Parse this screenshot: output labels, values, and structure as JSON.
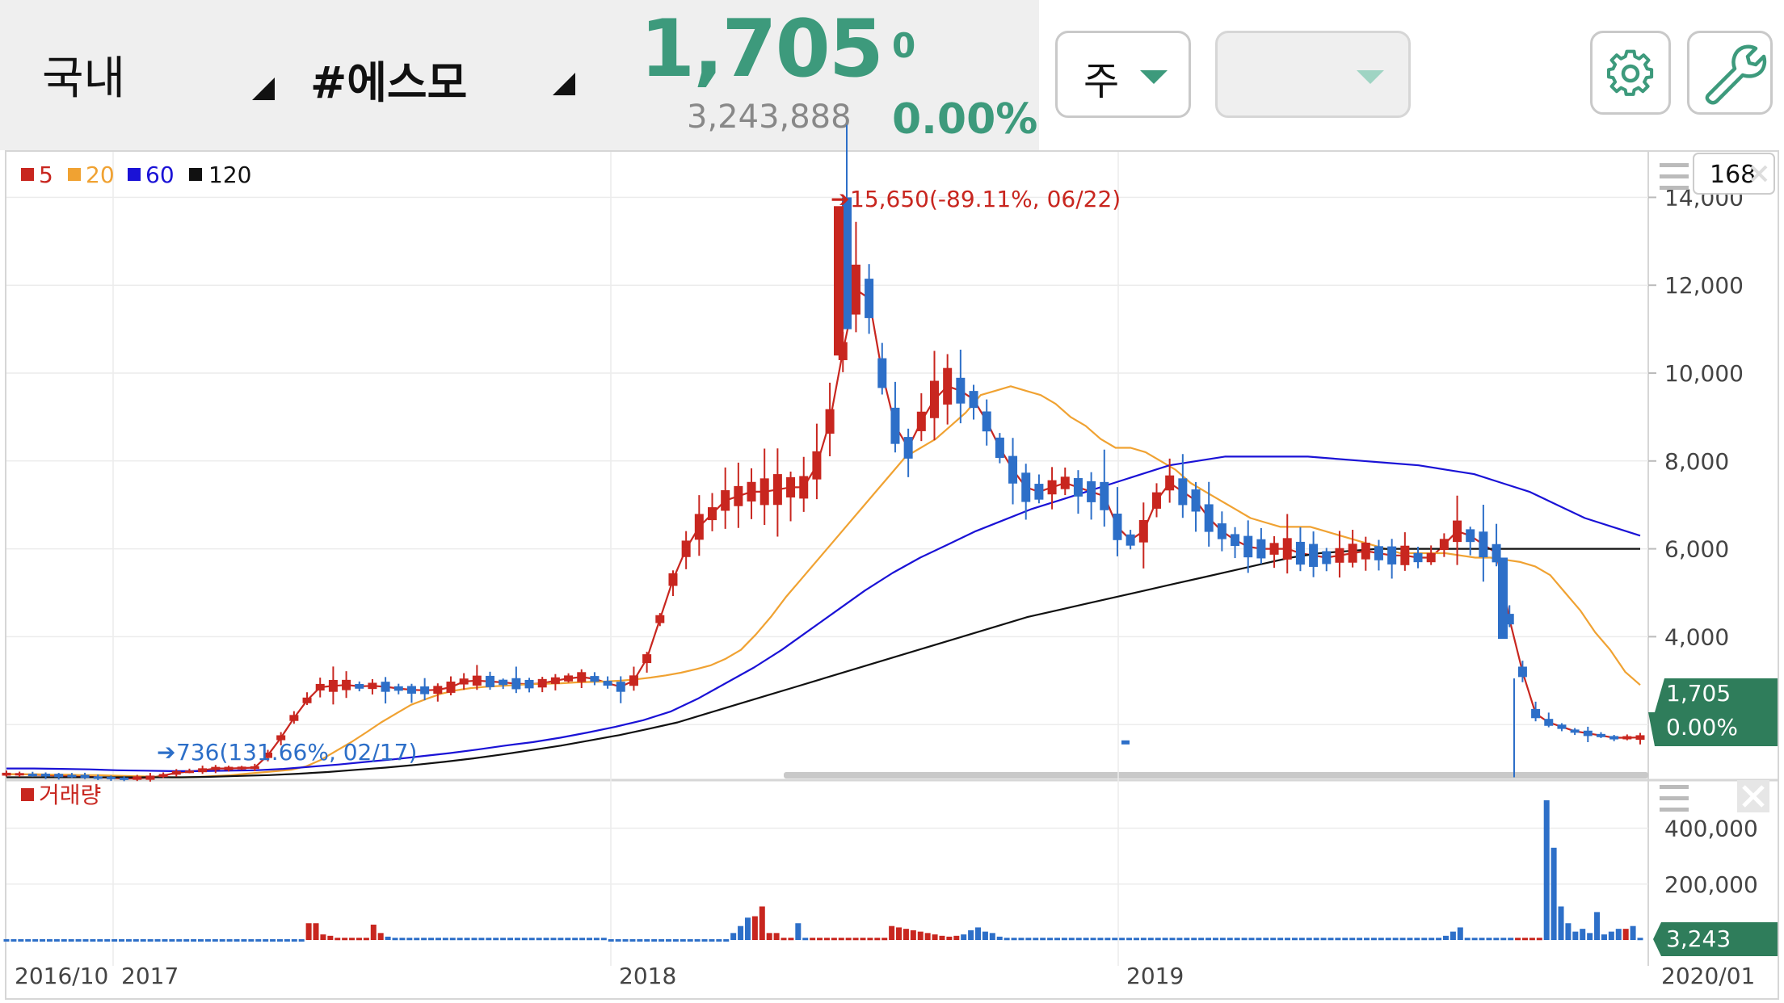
{
  "header": {
    "market": "국내",
    "stock": "#에스모",
    "price": "1,705",
    "volume": "3,243,888",
    "change": "0",
    "change_pct": "0.00%",
    "period": "주",
    "secondary_select": ""
  },
  "colors": {
    "up": "#c8261f",
    "down": "#2d6fc8",
    "accent": "#3d9a7c",
    "ma5": "#c8261f",
    "ma20": "#f0a232",
    "ma60": "#1a12d6",
    "ma120": "#111111"
  },
  "icons": {
    "settings": "gear-icon",
    "tools": "wrench-icon",
    "menu": "hamburger-icon",
    "close": "close-icon"
  },
  "chart_data": [
    {
      "type": "candlestick",
      "legend": [
        {
          "label": "5",
          "color": "#c8261f"
        },
        {
          "label": "20",
          "color": "#f0a232"
        },
        {
          "label": "60",
          "color": "#1a12d6"
        },
        {
          "label": "120",
          "color": "#111111"
        }
      ],
      "visible_count": "168",
      "yticks": [
        "14,000",
        "12,000",
        "10,000",
        "8,000",
        "6,000",
        "4,000"
      ],
      "ytick_values": [
        14000,
        12000,
        10000,
        8000,
        6000,
        4000
      ],
      "ylim": [
        0,
        15700
      ],
      "xticks": [
        "2016/10",
        "2017",
        "2018",
        "2019",
        "2020/01"
      ],
      "high_annotation": "15,650(-89.11%, 06/22)",
      "low_annotation": "736(131.66%, 02/17)",
      "last_price_label": "1,705",
      "last_pct_label": "0.00%",
      "series": [
        {
          "name": "5",
          "values": [
            870,
            870,
            860,
            850,
            840,
            830,
            820,
            800,
            790,
            770,
            780,
            790,
            840,
            900,
            930,
            960,
            1000,
            1000,
            1010,
            1020,
            1300,
            1700,
            2150,
            2550,
            2850,
            2880,
            2900,
            2870,
            2880,
            2860,
            2820,
            2790,
            2780,
            2790,
            2850,
            2980,
            3000,
            2980,
            2960,
            2930,
            2920,
            2940,
            3000,
            3050,
            3080,
            3040,
            2940,
            2860,
            3000,
            3500,
            4400,
            5300,
            6000,
            6500,
            6800,
            7100,
            7200,
            7300,
            7300,
            7350,
            7400,
            7400,
            7900,
            8900,
            10500,
            11900,
            11700,
            10000,
            8800,
            8300,
            8900,
            9400,
            9700,
            9600,
            9400,
            8900,
            8300,
            7800,
            7400,
            7300,
            7400,
            7500,
            7400,
            7300,
            7200,
            6500,
            6200,
            6400,
            7100,
            7500,
            7300,
            7100,
            6700,
            6400,
            6200,
            6050,
            6000,
            6000,
            6000,
            5900,
            5850,
            5800,
            5850,
            5900,
            5950,
            5900,
            5850,
            5850,
            5800,
            5800,
            6100,
            6400,
            6300,
            6100,
            5900,
            4400,
            3200,
            2250,
            2050,
            1950,
            1850,
            1800,
            1750,
            1700,
            1700,
            1705
          ]
        },
        {
          "name": "20",
          "values": [
            870,
            870,
            870,
            860,
            860,
            850,
            850,
            840,
            830,
            820,
            810,
            800,
            800,
            810,
            830,
            850,
            880,
            910,
            940,
            970,
            1050,
            1200,
            1400,
            1600,
            1820,
            2050,
            2250,
            2450,
            2580,
            2700,
            2780,
            2830,
            2860,
            2880,
            2900,
            2920,
            2930,
            2940,
            2960,
            2970,
            2980,
            3000,
            3030,
            3070,
            3120,
            3180,
            3260,
            3350,
            3500,
            3700,
            4050,
            4450,
            4900,
            5300,
            5700,
            6100,
            6500,
            6900,
            7300,
            7700,
            8100,
            8300,
            8500,
            8800,
            9100,
            9500,
            9600,
            9700,
            9600,
            9500,
            9300,
            9000,
            8800,
            8500,
            8300,
            8300,
            8200,
            8000,
            7800,
            7500,
            7300,
            7100,
            6900,
            6700,
            6600,
            6500,
            6500,
            6500,
            6400,
            6300,
            6200,
            6100,
            6000,
            5900,
            5900,
            5900,
            5900,
            5850,
            5800,
            5800,
            5750,
            5700,
            5600,
            5400,
            5000,
            4600,
            4100,
            3700,
            3200,
            2900
          ]
        },
        {
          "name": "60",
          "values": [
            1000,
            1000,
            990,
            980,
            960,
            950,
            940,
            940,
            950,
            960,
            990,
            1040,
            1090,
            1150,
            1210,
            1280,
            1350,
            1430,
            1520,
            1600,
            1700,
            1820,
            1950,
            2100,
            2300,
            2600,
            2950,
            3300,
            3700,
            4150,
            4600,
            5050,
            5450,
            5800,
            6100,
            6400,
            6650,
            6900,
            7100,
            7300,
            7500,
            7700,
            7900,
            8000,
            8100,
            8100,
            8100,
            8100,
            8050,
            8000,
            7950,
            7900,
            7800,
            7700,
            7500,
            7300,
            7000,
            6700,
            6500,
            6300
          ]
        },
        {
          "name": "120",
          "values": [
            800,
            800,
            800,
            800,
            800,
            800,
            800,
            810,
            830,
            850,
            880,
            920,
            970,
            1020,
            1080,
            1150,
            1230,
            1320,
            1420,
            1520,
            1640,
            1760,
            1900,
            2050,
            2250,
            2450,
            2650,
            2850,
            3050,
            3250,
            3450,
            3650,
            3850,
            4050,
            4250,
            4450,
            4600,
            4750,
            4900,
            5050,
            5200,
            5350,
            5500,
            5650,
            5800,
            5900,
            5950,
            6000,
            6000,
            6000,
            6000,
            6000
          ]
        }
      ]
    },
    {
      "type": "bar",
      "legend": [
        {
          "label": "거래량",
          "color": "#c8261f"
        }
      ],
      "yticks": [
        "400,000",
        "200,000"
      ],
      "ytick_values": [
        400000,
        200000
      ],
      "ylim": [
        0,
        520000
      ],
      "last_volume_label": "3,243",
      "values": [
        3000,
        3000,
        3000,
        3000,
        3000,
        3000,
        3000,
        3000,
        3000,
        3000,
        3000,
        3000,
        3000,
        3000,
        3000,
        3000,
        3000,
        3000,
        3000,
        3000,
        3000,
        3000,
        3000,
        3000,
        3000,
        3000,
        3000,
        3000,
        3000,
        3000,
        3000,
        3000,
        3000,
        3000,
        3000,
        3000,
        3000,
        3000,
        3000,
        3000,
        3000,
        3000,
        60000,
        60000,
        20000,
        15000,
        8000,
        8000,
        8000,
        8000,
        8000,
        55000,
        25000,
        12000,
        8000,
        8000,
        8000,
        8000,
        8000,
        8000,
        8000,
        8000,
        8000,
        8000,
        8000,
        8000,
        8000,
        8000,
        8000,
        8000,
        8000,
        8000,
        8000,
        8000,
        8000,
        8000,
        8000,
        8000,
        8000,
        8000,
        8000,
        8000,
        8000,
        8000,
        3000,
        3000,
        3000,
        3000,
        3000,
        3000,
        3000,
        3000,
        3000,
        3000,
        3000,
        3000,
        3000,
        3000,
        3000,
        3000,
        3000,
        25000,
        50000,
        80000,
        85000,
        120000,
        25000,
        25000,
        8000,
        8000,
        60000,
        8000,
        8000,
        8000,
        8000,
        8000,
        8000,
        8000,
        8000,
        8000,
        8000,
        8000,
        8000,
        50000,
        45000,
        40000,
        35000,
        30000,
        25000,
        20000,
        15000,
        12000,
        15000,
        20000,
        35000,
        45000,
        30000,
        25000,
        12000,
        8000,
        8000,
        8000,
        8000,
        8000,
        8000,
        8000,
        8000,
        8000,
        8000,
        8000,
        8000,
        8000,
        8000,
        8000,
        8000,
        8000,
        8000,
        8000,
        8000,
        8000,
        8000,
        8000,
        8000,
        8000,
        8000,
        8000,
        8000,
        8000,
        8000,
        8000,
        8000,
        8000,
        8000,
        8000,
        8000,
        8000,
        8000,
        8000,
        8000,
        8000,
        8000,
        8000,
        8000,
        8000,
        8000,
        8000,
        8000,
        8000,
        8000,
        8000,
        8000,
        8000,
        8000,
        8000,
        8000,
        8000,
        8000,
        8000,
        8000,
        8000,
        15000,
        30000,
        45000,
        8000,
        8000,
        8000,
        8000,
        8000,
        8000,
        8000,
        8000,
        8000,
        8000,
        8000,
        500000,
        330000,
        120000,
        60000,
        30000,
        40000,
        25000,
        100000,
        20000,
        30000,
        40000,
        40000,
        50000,
        8000
      ],
      "up_flags": "0000000000000000000000000000000000000000001111111111100000000000000000000000000000000000000000000000000011111100111111111111111111111000000000000000000000000000000000000000000000000000000000000000000000000000001111000000000001000000000111110"
    }
  ]
}
